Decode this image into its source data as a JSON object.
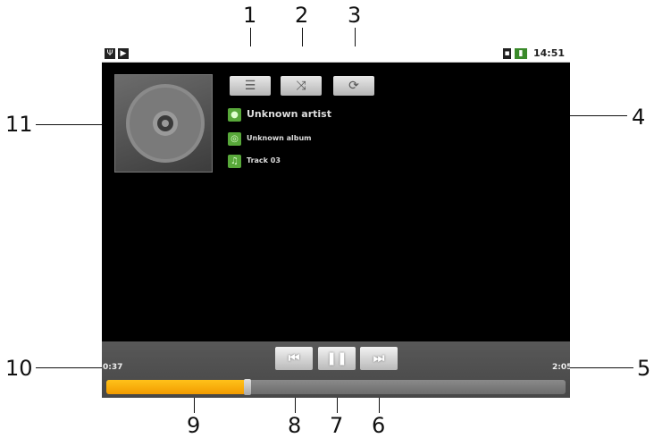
{
  "status_bar": {
    "time": "14:51"
  },
  "toolbar": {
    "playlist_icon": "playlist-icon",
    "shuffle_icon": "shuffle-icon",
    "repeat_icon": "repeat-icon"
  },
  "track_info": {
    "artist": "Unknown artist",
    "album": "Unknown album",
    "track": "Track 03"
  },
  "playback": {
    "elapsed": "0:37",
    "duration": "2:05",
    "progress_fraction": 0.3
  },
  "callouts": [
    "1",
    "2",
    "3",
    "4",
    "5",
    "6",
    "7",
    "8",
    "9",
    "10",
    "11"
  ],
  "colors": {
    "screen_bg": "#000000",
    "progress": "#f5a800",
    "meta_icon": "#58a83a"
  }
}
